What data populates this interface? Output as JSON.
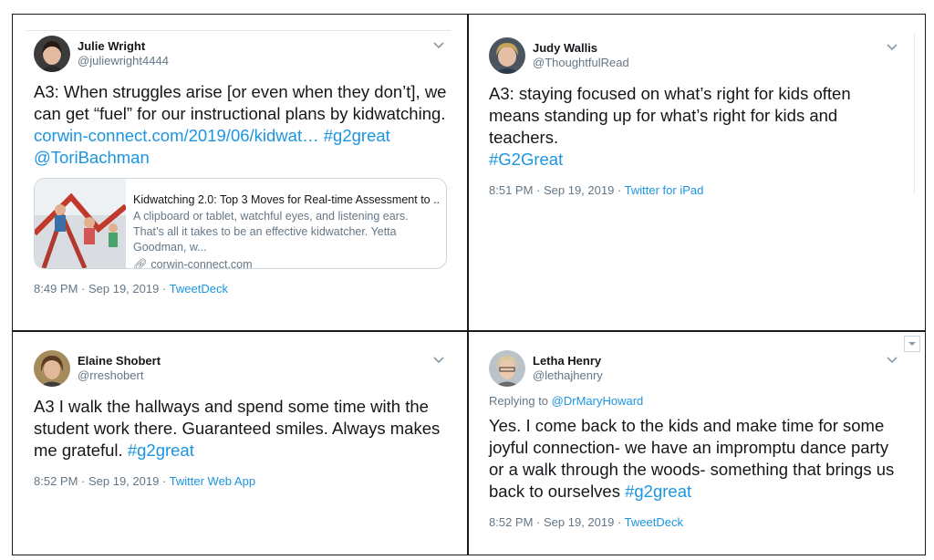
{
  "tweets": [
    {
      "name": "Julie Wright",
      "handle": "@juliewright4444",
      "text_parts": [
        "A3: When struggles arise [or even when they don’t], we can get “fuel” for our instructional plans by kidwatching. "
      ],
      "link_text": "corwin-connect.com/2019/06/kidwat…",
      "hashtags": "#g2great",
      "mention": "@ToriBachman",
      "card": {
        "title": "Kidwatching 2.0: Top 3 Moves for Real-time Assessment to ...",
        "description": "A clipboard or tablet, watchful eyes, and listening ears. That’s all it takes to be an effective kidwatcher. Yetta Goodman, w...",
        "domain": "corwin-connect.com"
      },
      "time": "8:49 PM · Sep 19, 2019 · ",
      "source": "TweetDeck"
    },
    {
      "name": "Judy Wallis",
      "handle": "@ThoughtfulRead",
      "text": "A3: staying focused on what’s right for kids often means standing up for what’s right for kids and teachers.",
      "hashtag": "#G2Great",
      "time": "8:51 PM · Sep 19, 2019 · ",
      "source": "Twitter for iPad"
    },
    {
      "name": "Elaine Shobert",
      "handle": "@rreshobert",
      "text": "A3 I walk the hallways and spend some time with the student work there. Guaranteed smiles. Always makes me grateful. ",
      "hashtag": "#g2great",
      "time": "8:52 PM · Sep 19, 2019 · ",
      "source": "Twitter Web App"
    },
    {
      "name": "Letha Henry",
      "handle": "@lethajhenry",
      "reply_prefix": "Replying to ",
      "reply_to": "@DrMaryHoward",
      "text": "Yes. I come back to the kids and make time for some joyful connection- we have an impromptu dance party or a walk through the woods- something that brings us back to ourselves ",
      "hashtag": "#g2great",
      "time": "8:52 PM · Sep 19, 2019 · ",
      "source": "TweetDeck"
    }
  ],
  "icons": {
    "caret": "chevron-down-icon",
    "link": "link-icon"
  },
  "colors": {
    "link": "#1b95e0",
    "muted": "#657786",
    "border": "#1a1a1a"
  }
}
